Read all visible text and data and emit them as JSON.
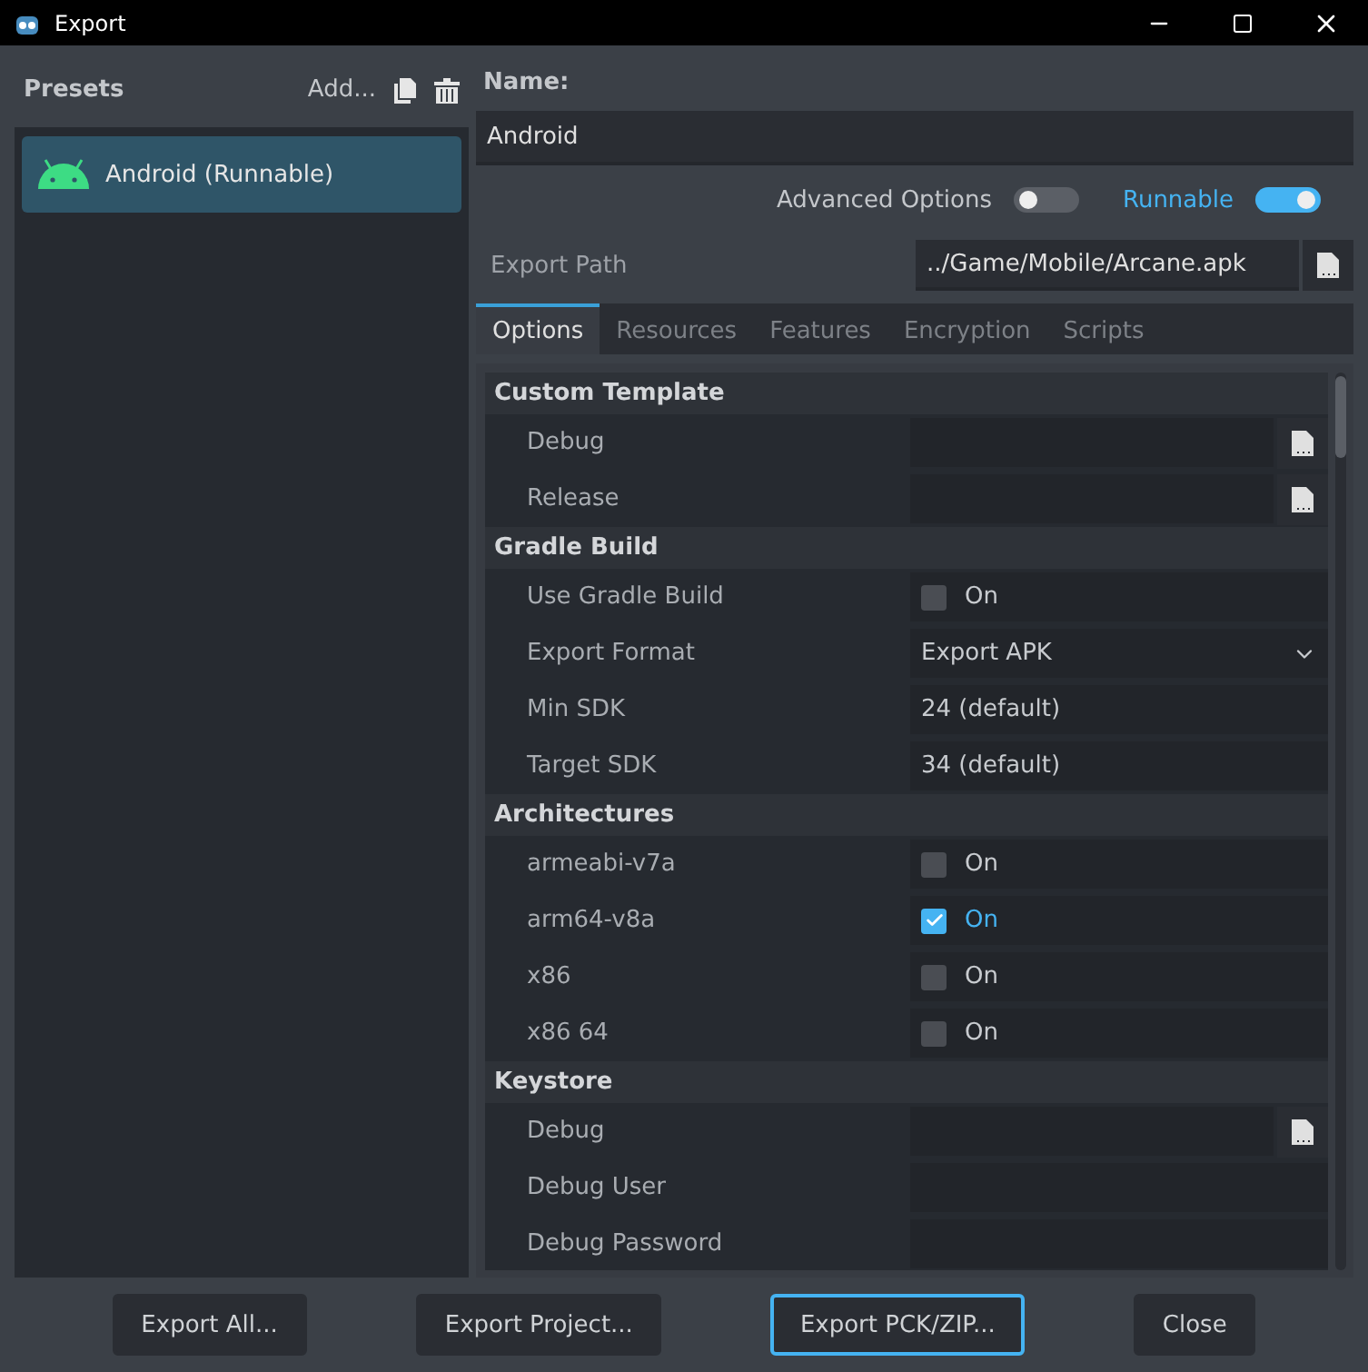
{
  "window": {
    "title": "Export"
  },
  "presets": {
    "title": "Presets",
    "add_label": "Add...",
    "items": [
      {
        "label": "Android (Runnable)",
        "selected": true
      }
    ]
  },
  "name": {
    "label": "Name:",
    "value": "Android"
  },
  "toggles": [
    {
      "label": "Advanced Options",
      "on": false
    },
    {
      "label": "Runnable",
      "on": true
    }
  ],
  "export_path": {
    "label": "Export Path",
    "value": "../Game/Mobile/Arcane.apk"
  },
  "tabs": [
    {
      "label": "Options",
      "selected": true
    },
    {
      "label": "Resources",
      "selected": false
    },
    {
      "label": "Features",
      "selected": false
    },
    {
      "label": "Encryption",
      "selected": false
    },
    {
      "label": "Scripts",
      "selected": false
    }
  ],
  "sections": [
    {
      "title": "Custom Template",
      "rows": [
        {
          "kind": "file",
          "label": "Debug"
        },
        {
          "kind": "file",
          "label": "Release"
        }
      ]
    },
    {
      "title": "Gradle Build",
      "rows": [
        {
          "kind": "check",
          "label": "Use Gradle Build",
          "value": "On",
          "checked": false
        },
        {
          "kind": "select",
          "label": "Export Format",
          "value": "Export APK"
        },
        {
          "kind": "text",
          "label": "Min SDK",
          "value": "24 (default)"
        },
        {
          "kind": "text",
          "label": "Target SDK",
          "value": "34 (default)"
        }
      ]
    },
    {
      "title": "Architectures",
      "rows": [
        {
          "kind": "check",
          "label": "armeabi-v7a",
          "value": "On",
          "checked": false
        },
        {
          "kind": "check",
          "label": "arm64-v8a",
          "value": "On",
          "checked": true
        },
        {
          "kind": "check",
          "label": "x86",
          "value": "On",
          "checked": false
        },
        {
          "kind": "check",
          "label": "x86 64",
          "value": "On",
          "checked": false
        }
      ]
    },
    {
      "title": "Keystore",
      "rows": [
        {
          "kind": "file",
          "label": "Debug"
        },
        {
          "kind": "text",
          "label": "Debug User"
        },
        {
          "kind": "text",
          "label": "Debug Password"
        }
      ]
    }
  ],
  "buttons": [
    {
      "label": "Export All...",
      "focused": false
    },
    {
      "label": "Export Project...",
      "focused": false
    },
    {
      "label": "Export PCK/ZIP...",
      "focused": true
    },
    {
      "label": "Close",
      "focused": false
    }
  ]
}
